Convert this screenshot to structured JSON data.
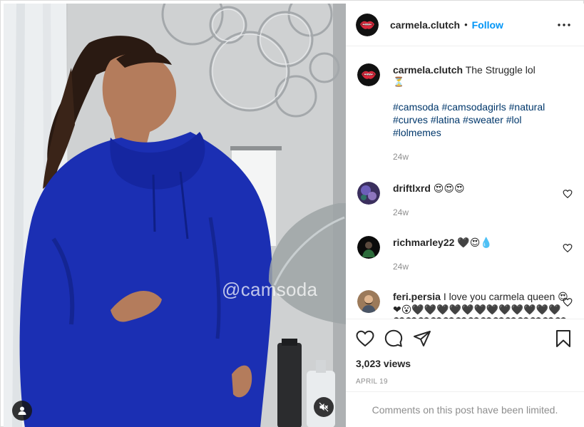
{
  "post": {
    "author": "carmela.clutch",
    "follow_label": "Follow",
    "separator": "•",
    "watermark": "@camsoda"
  },
  "caption": {
    "username": "carmela.clutch",
    "text": "The Struggle lol",
    "emoji": "⏳",
    "hashtags": "#camsoda #camsodagirls #natural #curves #latina #sweater #lol #lolmemes",
    "age": "24w"
  },
  "comments": [
    {
      "username": "driftlxrd",
      "text": "😍😍😍",
      "age": "24w"
    },
    {
      "username": "richmarley22",
      "text": "🖤😍💧",
      "age": "24w"
    },
    {
      "username": "feri.persia",
      "text": "I love you carmela queen 😍❤😮🖤🖤🖤🖤🖤🖤🖤🖤🖤🖤🖤🖤🖤🖤🖤🖤🖤🖤🖤🖤🖤🖤🖤🖤🖤🖤🖤🖤"
    }
  ],
  "stats": {
    "views": "3,023 views",
    "date": "APRIL 19"
  },
  "comments_limited": "Comments on this post have been limited.",
  "colors": {
    "accent_link": "#0095f6",
    "hashtag": "#00376b",
    "muted_text": "#8e8e8e",
    "hoodie": "#1b2fb3"
  },
  "icons": {
    "like": "heart-icon",
    "comment": "comment-bubble-icon",
    "share": "paper-plane-icon",
    "save": "bookmark-icon",
    "more": "more-options-icon",
    "tag": "person-tag-icon",
    "mute": "speaker-muted-icon"
  }
}
